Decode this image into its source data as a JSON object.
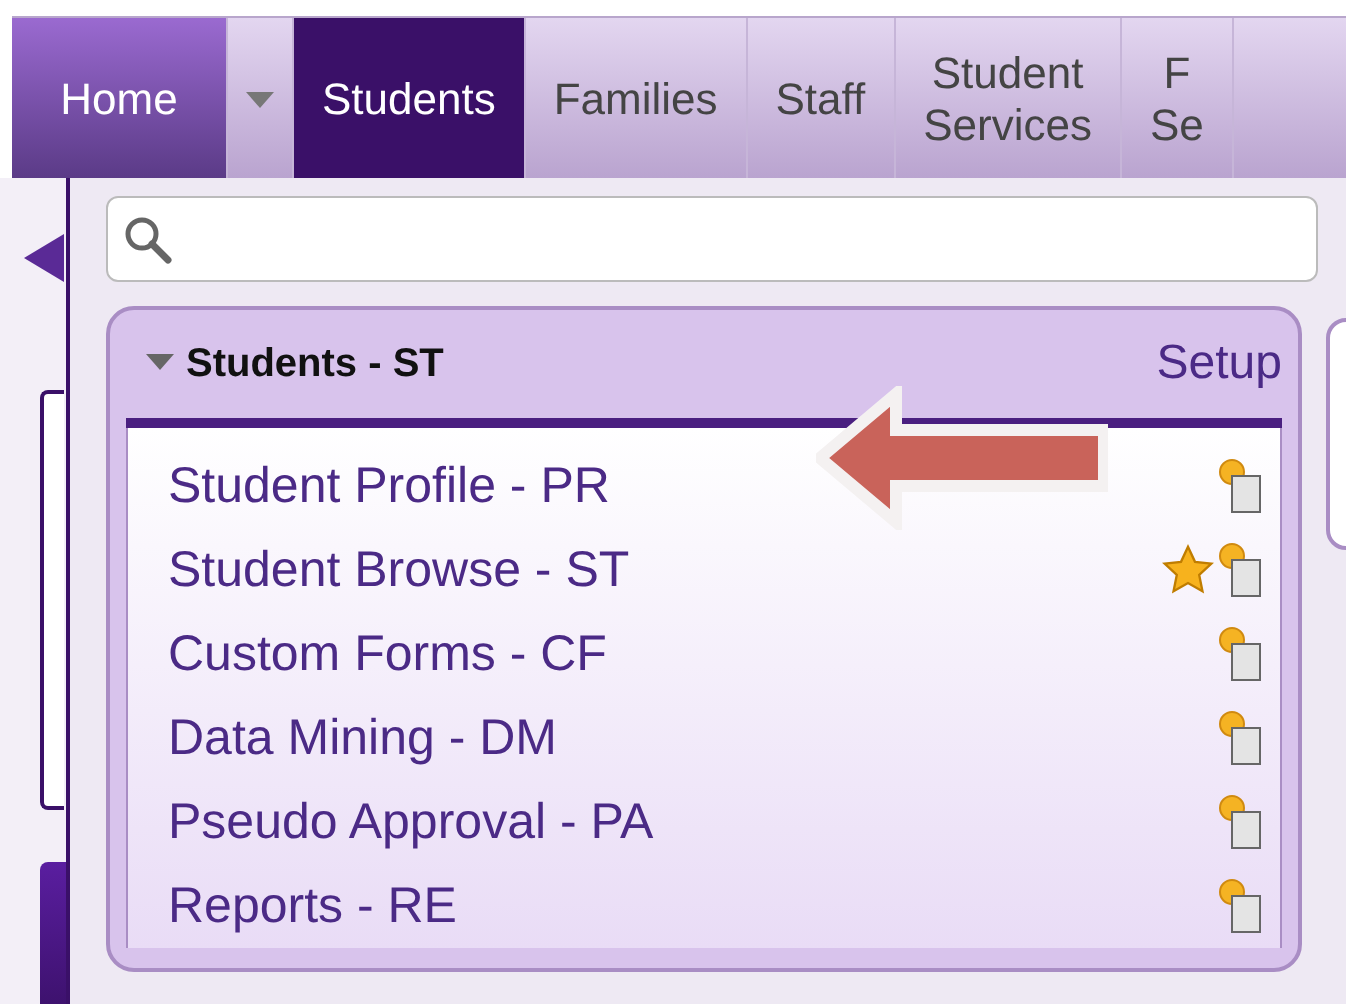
{
  "nav_tabs": [
    {
      "kind": "home",
      "lines": [
        "Home"
      ]
    },
    {
      "kind": "dropdown"
    },
    {
      "kind": "tab",
      "lines": [
        "Students"
      ],
      "selected": true
    },
    {
      "kind": "tab",
      "lines": [
        "Families"
      ],
      "selected": false
    },
    {
      "kind": "tab",
      "lines": [
        "Staff"
      ],
      "selected": false
    },
    {
      "kind": "tab",
      "lines": [
        "Student",
        "Services"
      ],
      "selected": false
    },
    {
      "kind": "tab",
      "lines": [
        "F",
        "Se"
      ],
      "selected": false
    }
  ],
  "panel": {
    "title": "Students - ST",
    "expanded": true,
    "setup_link": "Setup",
    "items": [
      {
        "label": "Student Profile - PR",
        "favorite": false
      },
      {
        "label": "Student Browse - ST",
        "favorite": true
      },
      {
        "label": "Custom Forms - CF",
        "favorite": false
      },
      {
        "label": "Data Mining - DM",
        "favorite": false
      },
      {
        "label": "Pseudo Approval - PA",
        "favorite": false
      },
      {
        "label": "Reports - RE",
        "favorite": false
      }
    ]
  }
}
